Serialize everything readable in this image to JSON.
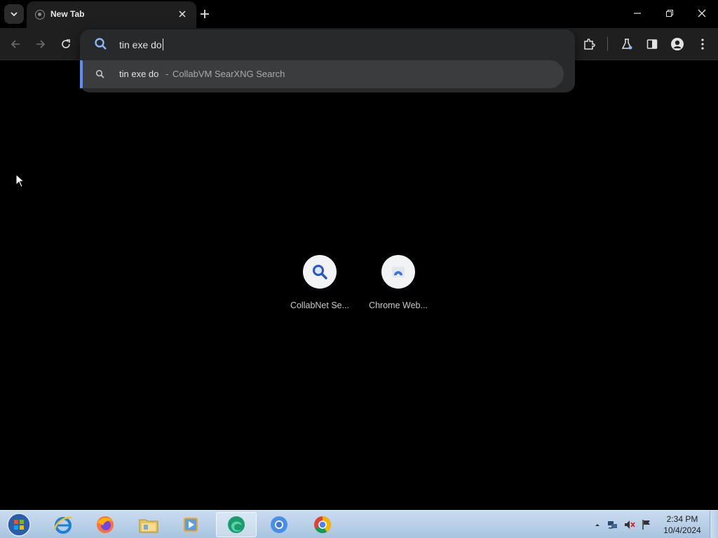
{
  "window": {
    "tab_title": "New Tab"
  },
  "omnibox": {
    "input_value": "tin exe do",
    "suggestion_query": "tin exe do",
    "suggestion_separator": "-",
    "suggestion_source": "CollabVM SearXNG Search"
  },
  "shortcuts": [
    {
      "label": "CollabNet Se...",
      "icon": "search-icon"
    },
    {
      "label": "Chrome Web...",
      "icon": "chrome-web-store-icon"
    }
  ],
  "taskbar": {
    "apps": [
      "internet-explorer-icon",
      "firefox-icon",
      "file-explorer-icon",
      "media-player-icon",
      "edge-icon",
      "chromium-icon",
      "chrome-icon"
    ],
    "clock_time": "2:34 PM",
    "clock_date": "10/4/2024"
  },
  "colors": {
    "accent": "#5d8ef5",
    "search_icon": "#8ab4f8",
    "page_background": "#000000",
    "toolbar": "#1f1f1f"
  }
}
